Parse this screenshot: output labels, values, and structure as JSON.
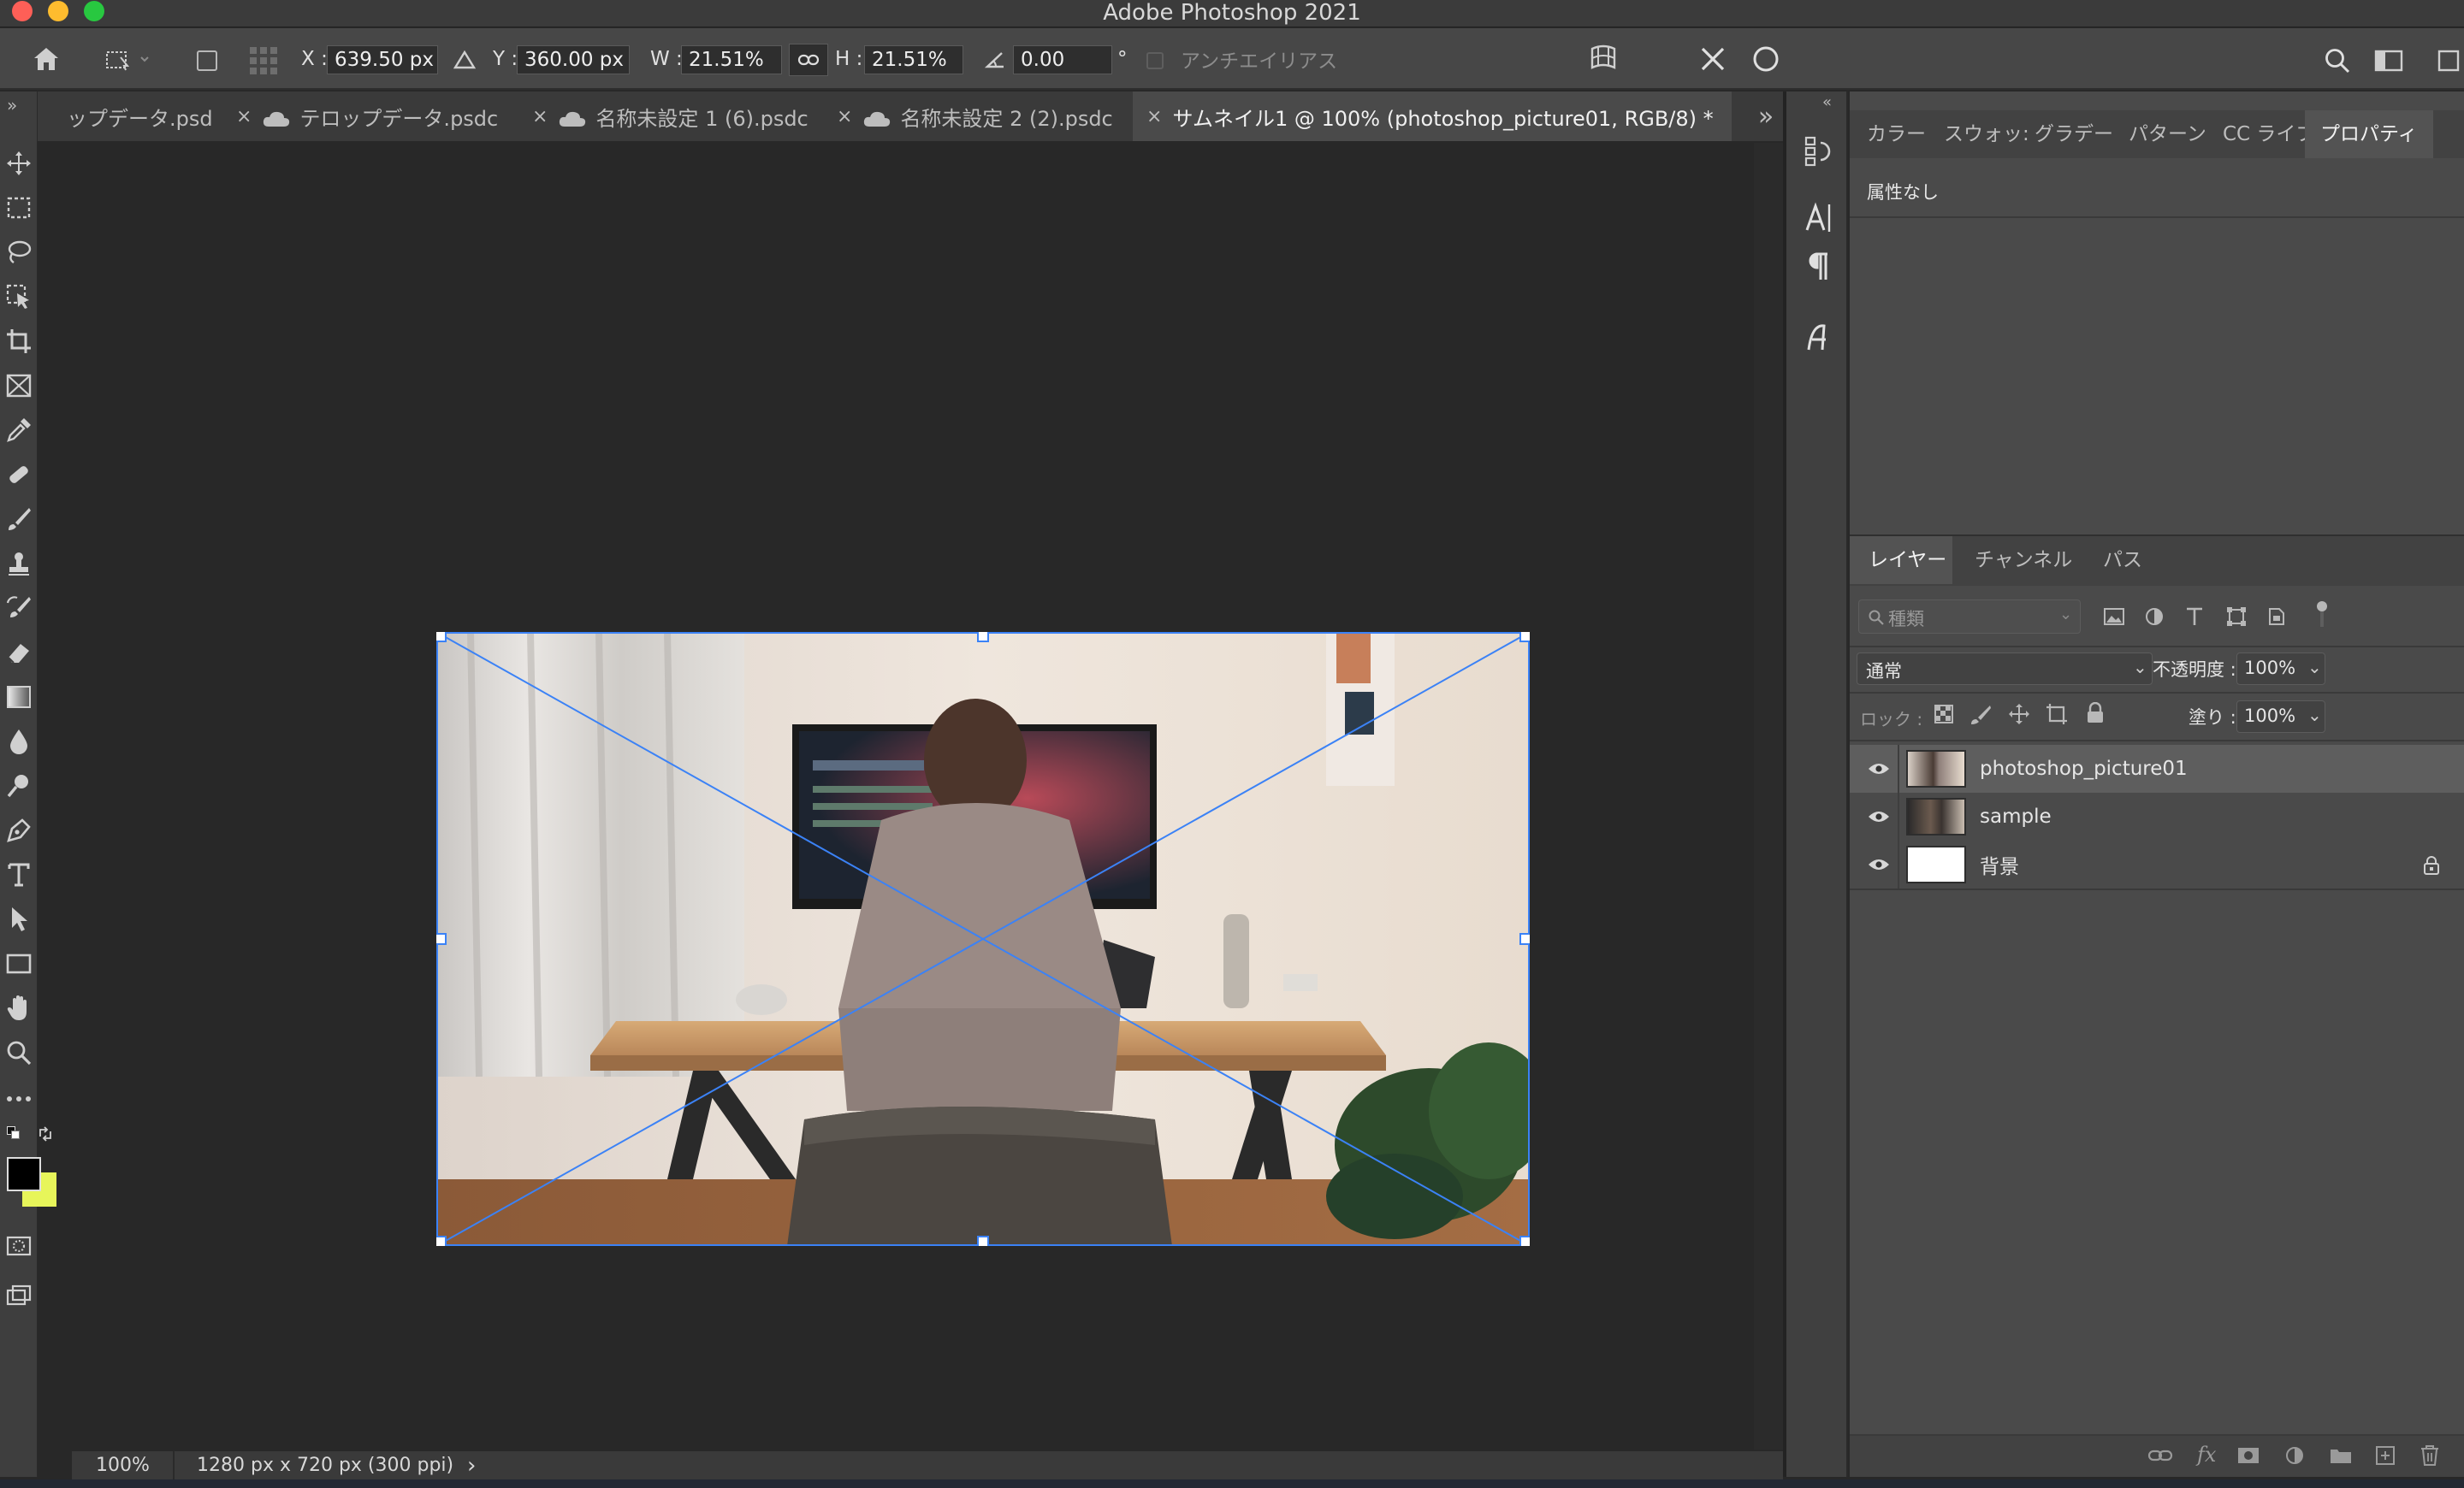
{
  "window": {
    "title": "Adobe Photoshop 2021"
  },
  "options_bar": {
    "x_label": "X :",
    "x_value": "639.50 px",
    "y_label": "Y :",
    "y_value": "360.00 px",
    "w_label": "W :",
    "w_value": "21.51%",
    "h_label": "H :",
    "h_value": "21.51%",
    "angle_value": "0.00",
    "angle_unit": "°",
    "antialias_label": "アンチエイリアス"
  },
  "tabs": [
    {
      "label": "ップデータ.psd",
      "cloud": false,
      "active": false
    },
    {
      "label": "テロップデータ.psdc",
      "cloud": true,
      "active": false
    },
    {
      "label": "名称未設定 1 (6).psdc",
      "cloud": true,
      "active": false
    },
    {
      "label": "名称未設定 2 (2).psdc",
      "cloud": true,
      "active": false
    },
    {
      "label": "サムネイル1 @ 100% (photoshop_picture01, RGB/8) *",
      "cloud": false,
      "active": true
    }
  ],
  "tabs_close_glyph": "×",
  "tabs_overflow": "»",
  "status": {
    "zoom": "100%",
    "doc_info": "1280 px x 720 px (300 ppi)",
    "arrow": "›"
  },
  "properties_panel": {
    "tabs": [
      "カラー",
      "スウォッ:",
      "グラデー",
      "パターン",
      "CC ライブ",
      "プロパティ"
    ],
    "active_tab": "プロパティ",
    "empty_text": "属性なし"
  },
  "layers_panel": {
    "tabs": [
      "レイヤー",
      "チャンネル",
      "パス"
    ],
    "filter_placeholder": "種類",
    "blend_mode": "通常",
    "opacity_label": "不透明度 :",
    "opacity_value": "100%",
    "lock_label": "ロック :",
    "fill_label": "塗り :",
    "fill_value": "100%",
    "layers": [
      {
        "name": "photoshop_picture01",
        "selected": true,
        "locked": false,
        "thumb": "photo"
      },
      {
        "name": "sample",
        "selected": false,
        "locked": false,
        "thumb": "photo-dark"
      },
      {
        "name": "背景",
        "selected": false,
        "locked": true,
        "thumb": "white"
      }
    ]
  },
  "colors": {
    "foreground": "#000000",
    "background": "#e7f55a",
    "selection": "#3b82f6"
  }
}
